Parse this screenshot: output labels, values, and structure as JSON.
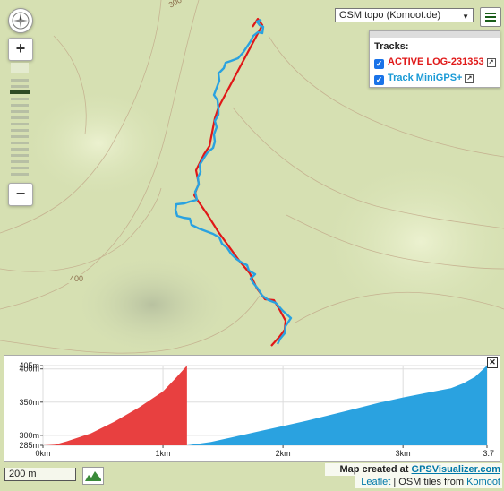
{
  "map": {
    "contour_labels": [
      "300",
      "400"
    ],
    "basemap_selected": "OSM topo (Komoot.de)",
    "colors": {
      "track_active": "#e01818",
      "track_minigps": "#2aa2e0",
      "terrain": "#d9e3b7"
    }
  },
  "controls": {
    "compass_icon": "compass-icon",
    "zoom_in_label": "+",
    "zoom_out_label": "−",
    "menu_icon": "menu-icon"
  },
  "tracks": {
    "title": "Tracks:",
    "items": [
      {
        "name": "ACTIVE LOG-231353",
        "color": "#e01818",
        "checked": true
      },
      {
        "name": "Track MiniGPS+",
        "color": "#1a9ad6",
        "checked": true
      }
    ]
  },
  "profile": {
    "close_label": "✕",
    "y_tick_labels": [
      "405m",
      "400m",
      "350m",
      "300m",
      "285m"
    ],
    "x_tick_labels": [
      "0km",
      "1km",
      "2km",
      "3km",
      "3.7"
    ]
  },
  "chart_data": {
    "type": "area",
    "ylim": [
      285,
      405
    ],
    "xlim": [
      0,
      3.7
    ],
    "x_ticks": [
      0,
      1,
      2,
      3,
      3.7
    ],
    "y_ticks": [
      405,
      400,
      350,
      300,
      285
    ],
    "grid": true,
    "series": [
      {
        "name": "ACTIVE LOG-231353",
        "color": "#e84040",
        "x": [
          0,
          0.1,
          0.2,
          0.4,
          0.6,
          0.8,
          1.0,
          1.1,
          1.2
        ],
        "y": [
          285,
          286,
          291,
          303,
          321,
          342,
          366,
          385,
          405
        ]
      },
      {
        "name": "Track MiniGPS+",
        "color": "#2aa2e0",
        "x": [
          1.2,
          1.4,
          1.6,
          1.8,
          2.0,
          2.2,
          2.4,
          2.6,
          2.8,
          3.0,
          3.2,
          3.4,
          3.5,
          3.6,
          3.7
        ],
        "y": [
          285,
          290,
          298,
          306,
          314,
          322,
          331,
          340,
          349,
          357,
          364,
          371,
          378,
          388,
          405
        ]
      }
    ]
  },
  "footer": {
    "scale_label": "200 m",
    "profile_toggle_icon": "elevation-profile-icon",
    "credit_prefix": "Map created at ",
    "credit_link": "GPSVisualizer.com",
    "attrib_leaflet": "Leaflet",
    "attrib_sep": " | OSM tiles from ",
    "attrib_komoot": "Komoot"
  }
}
